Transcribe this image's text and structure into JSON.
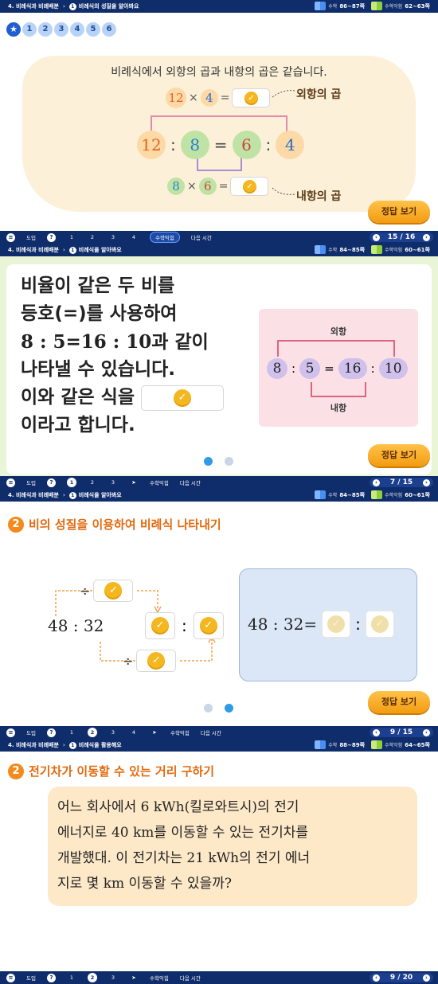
{
  "slide1": {
    "breadcrumb_unit": "4. 비례식과 비례배분",
    "breadcrumb_lesson_num": "1",
    "breadcrumb_lesson": "비례식의 성질을 알아봐요",
    "ref_math_label": "수학",
    "ref_math_pages": "86~87쪽",
    "ref_workbook_label": "수학익힘",
    "ref_workbook_pages": "62~63쪽",
    "steps": [
      "1",
      "2",
      "3",
      "4",
      "5",
      "6"
    ],
    "statement": "비례식에서 외항의 곱과 내항의 곱은 같습니다.",
    "outer_product": {
      "a": "12",
      "b": "4",
      "op": "×",
      "eq": "="
    },
    "inner_product": {
      "a": "8",
      "b": "6",
      "op": "×",
      "eq": "="
    },
    "proportion": [
      "12",
      ":",
      "8",
      "=",
      "6",
      ":",
      "4"
    ],
    "outer_label": "외항의 곱",
    "inner_label": "내항의 곱",
    "answer_button": "정답 보기",
    "bottom": {
      "menu": "도입",
      "help": "?",
      "nums": [
        "1",
        "2",
        "3",
        "4"
      ],
      "pill": "수학익힘",
      "next": "다음 시간",
      "page": "15 / 16"
    }
  },
  "slide2": {
    "breadcrumb_unit": "4. 비례식과 비례배분",
    "breadcrumb_lesson_num": "1",
    "breadcrumb_lesson": "비례식을 알아봐요",
    "ref_math_label": "수학",
    "ref_math_pages": "84~85쪽",
    "ref_workbook_label": "수학익힘",
    "ref_workbook_pages": "60~61쪽",
    "lines": [
      "비율이 같은 두 비를",
      "등호(=)를 사용하여",
      "8 : 5=16 : 10과 같이",
      "나타낼 수 있습니다.",
      "이와 같은 식을",
      "이라고 합니다."
    ],
    "diagram": {
      "outer_label": "외항",
      "inner_label": "내항",
      "terms": [
        "8",
        ":",
        "5",
        "=",
        "16",
        ":",
        "10"
      ]
    },
    "answer_button": "정답 보기",
    "bottom": {
      "menu": "도입",
      "help": "?",
      "nums": [
        "1",
        "2",
        "3",
        "4"
      ],
      "active": "1",
      "pill": "수학익힘",
      "next": "다음 시간",
      "page": "7 / 15"
    }
  },
  "slide3": {
    "breadcrumb_unit": "4. 비례식과 비례배분",
    "breadcrumb_lesson_num": "1",
    "breadcrumb_lesson": "비례식을 알아봐요",
    "ref_math_label": "수학",
    "ref_math_pages": "84~85쪽",
    "ref_workbook_label": "수학익힘",
    "ref_workbook_pages": "60~61쪽",
    "section_no": "2",
    "section_title": "비의 성질을 이용하여 비례식 나타내기",
    "ratio_left": "48 : 32",
    "div_sign": "÷",
    "colon": ":",
    "result_expr": "48 : 32=",
    "answer_button": "정답 보기",
    "bottom": {
      "menu": "도입",
      "help": "?",
      "nums": [
        "1",
        "2",
        "3",
        "4"
      ],
      "active": "2",
      "pill": "수학익힘",
      "next": "다음 시간",
      "page": "9 / 15"
    }
  },
  "slide4": {
    "breadcrumb_unit": "4. 비례식과 비례배분",
    "breadcrumb_lesson_num": "1",
    "breadcrumb_lesson": "비례식을 활용해요",
    "ref_math_label": "수학",
    "ref_math_pages": "88~89쪽",
    "ref_workbook_label": "수학익힘",
    "ref_workbook_pages": "64~65쪽",
    "section_no": "2",
    "section_title": "전기차가 이동할 수 있는 거리 구하기",
    "problem_lines": [
      "어느 회사에서 6 kWh(킬로와트시)의 전기",
      "에너지로 40 km를 이동할 수 있는 전기차를",
      "개발했대. 이 전기차는 21 kWh의 전기 에너",
      "지로 몇 km 이동할 수 있을까?"
    ],
    "bottom": {
      "menu": "도입",
      "help": "?",
      "nums": [
        "1",
        "2",
        "3"
      ],
      "active": "2",
      "pill": "수학익힘",
      "next": "다음 시간",
      "page": "9 / 20"
    }
  },
  "colors": {
    "navy": "#0f2d6b",
    "orange": "#f29c10",
    "gold": "#f5b71f",
    "cream": "#fdf0d8",
    "green_slide": "#eaf4d7",
    "pink_panel": "#fbe1e6",
    "blue_panel": "#dbe7f7"
  }
}
